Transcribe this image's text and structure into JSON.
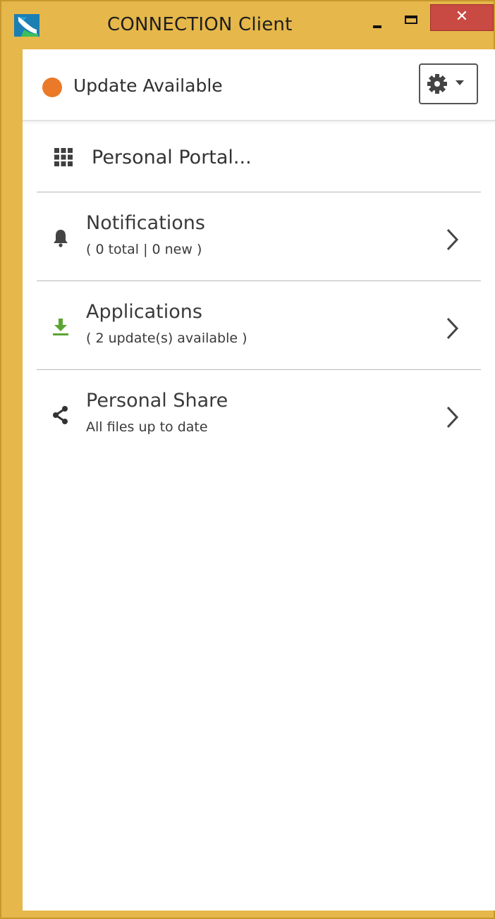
{
  "window": {
    "title": "CONNECTION Client",
    "minimize_glyph": "–",
    "close_glyph": "✕",
    "close_color": "#c94a43",
    "frame_color": "#e6b74a"
  },
  "status": {
    "text": "Update Available",
    "dot_color": "#ea7a28"
  },
  "settings": {
    "icon": "gear-icon",
    "caret": "chevron-down-icon"
  },
  "portal": {
    "icon": "apps-grid-icon",
    "label": "Personal Portal..."
  },
  "menu": {
    "items": [
      {
        "id": "notifications",
        "icon": "bell-icon",
        "title": "Notifications",
        "subtitle": "( 0 total | 0 new )"
      },
      {
        "id": "applications",
        "icon": "download-icon",
        "icon_color": "#5aa533",
        "title": "Applications",
        "subtitle": "( 2 update(s) available )"
      },
      {
        "id": "personal-share",
        "icon": "share-icon",
        "title": "Personal Share",
        "subtitle": "All files up to date"
      }
    ]
  }
}
